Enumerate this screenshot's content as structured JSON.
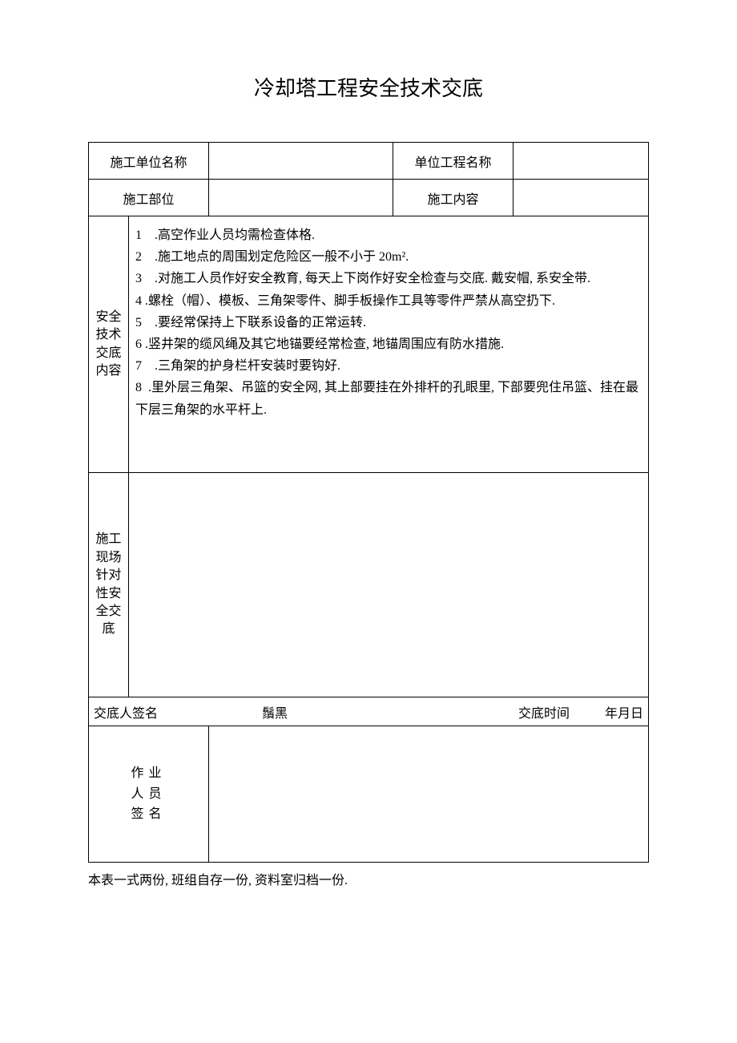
{
  "title": "冷却塔工程安全技术交底",
  "header": {
    "unit_name_label": "施工单位名称",
    "project_name_label": "单位工程名称",
    "location_label": "施工部位",
    "content_label": "施工内容",
    "unit_name_value": "",
    "project_name_value": "",
    "location_value": "",
    "content_value": ""
  },
  "section1": {
    "label": "安全技术交底内容",
    "items": [
      {
        "num": "1",
        "text": "    .高空作业人员均需检查体格."
      },
      {
        "num": "2",
        "text": "    .施工地点的周围划定危险区一般不小于 20m²."
      },
      {
        "num": "3",
        "text": "    .对施工人员作好安全教育, 每天上下岗作好安全检查与交底. 戴安帽, 系安全带."
      },
      {
        "num": "4",
        "text": " .螺栓（帽）、模板、三角架零件、脚手板操作工具等零件严禁从高空扔下."
      },
      {
        "num": "5",
        "text": "    .要经常保持上下联系设备的正常运转."
      },
      {
        "num": "6",
        "text": " .竖井架的缆风绳及其它地锚要经常检查, 地锚周围应有防水措施."
      },
      {
        "num": "7",
        "text": "    .三角架的护身栏杆安装时要钩好."
      },
      {
        "num": "8",
        "text": "  .里外层三角架、吊篮的安全网, 其上部要挂在外排杆的孔眼里, 下部要兜住吊篮、挂在最下层三角架的水平杆上."
      }
    ]
  },
  "section2": {
    "label": "施工现场针对性安全交底",
    "value": ""
  },
  "signature": {
    "signer_label": "交底人签名",
    "signer_value": "鬚黑",
    "time_label": "交底时间",
    "date_value": "年月日"
  },
  "workers": {
    "label_line1": "作业",
    "label_line2": "人员",
    "label_line3": "签名",
    "value": ""
  },
  "footer": "本表一式两份, 班组自存一份, 资料室归档一份."
}
